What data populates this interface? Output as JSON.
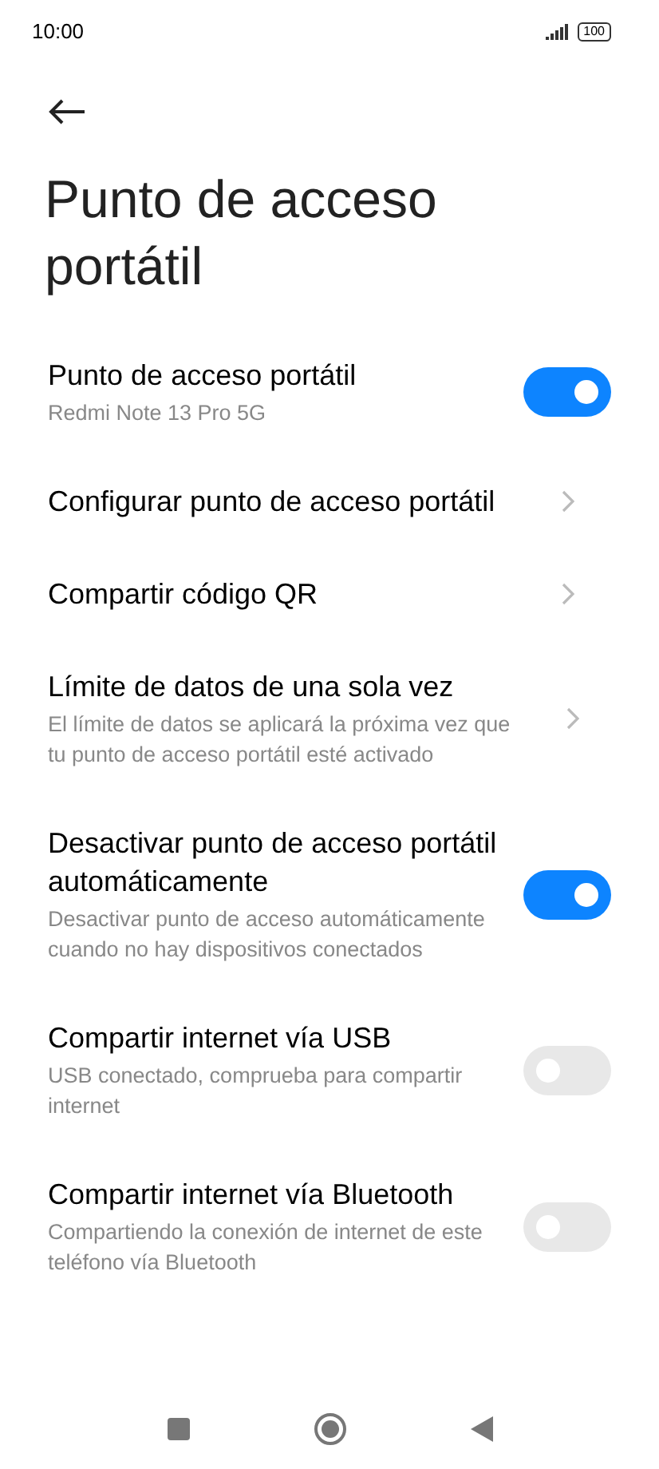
{
  "status_bar": {
    "time": "10:00",
    "battery": "100"
  },
  "title": "Punto de acceso portátil",
  "items": [
    {
      "kind": "toggle",
      "title": "Punto de acceso portátil",
      "subtitle": "Redmi Note 13 Pro 5G",
      "on": true
    },
    {
      "kind": "link",
      "title": "Configurar punto de acceso portátil"
    },
    {
      "kind": "link",
      "title": "Compartir código QR"
    },
    {
      "kind": "link",
      "title": "Límite de datos de una sola vez",
      "subtitle": "El límite de datos se aplicará la próxima vez que tu punto de acceso portátil esté activado"
    },
    {
      "kind": "toggle",
      "title": "Desactivar punto de acceso portátil automáticamente",
      "subtitle": "Desactivar punto de acceso automáticamente cuando no hay dispositivos conectados",
      "on": true
    },
    {
      "kind": "toggle",
      "title": "Compartir internet vía USB",
      "subtitle": "USB conectado, comprueba para compartir internet",
      "on": false
    },
    {
      "kind": "toggle",
      "title": "Compartir internet vía Bluetooth",
      "subtitle": "Compartiendo la conexión de internet de este teléfono vía Bluetooth",
      "on": false
    }
  ]
}
